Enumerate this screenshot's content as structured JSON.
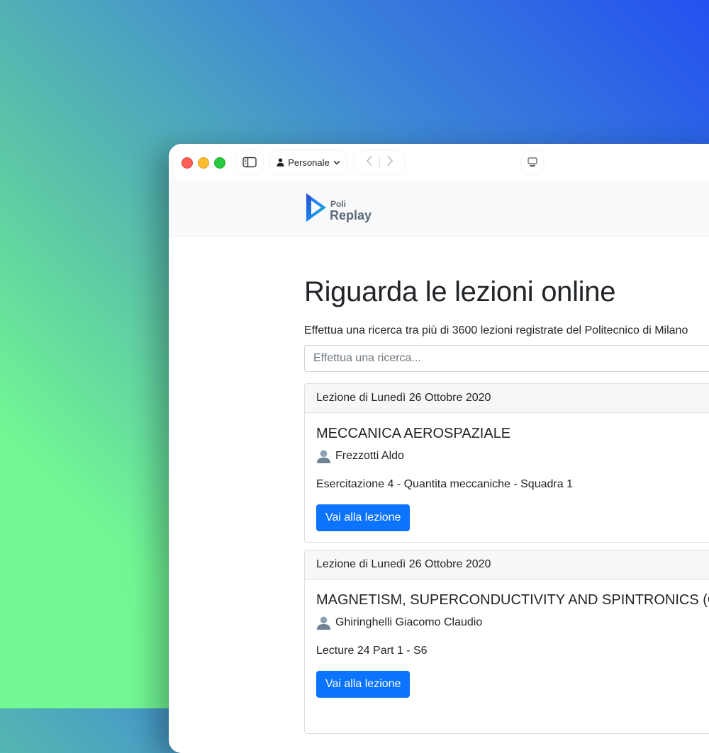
{
  "browser": {
    "profile_label": "Personale"
  },
  "brand": {
    "line1": "Poli",
    "line2": "Replay"
  },
  "page": {
    "title": "Riguarda le lezioni online",
    "subtitle": "Effettua una ricerca tra più di 3600 lezioni registrate del Politecnico di Milano"
  },
  "search": {
    "placeholder": "Effettua una ricerca...",
    "value": ""
  },
  "lessons": [
    {
      "date_header": "Lezione di Lunedì 26 Ottobre 2020",
      "course": "MECCANICA AEROSPAZIALE",
      "teacher": "Frezzotti Aldo",
      "lesson_title": "Esercitazione 4 - Quantita meccaniche - Squadra 1",
      "button_label": "Vai alla lezione"
    },
    {
      "date_header": "Lezione di Lunedì 26 Ottobre 2020",
      "course": "MAGNETISM, SUPERCONDUCTIVITY AND SPINTRONICS (C.I.)",
      "teacher": "Ghiringhelli Giacomo Claudio",
      "lesson_title": "Lecture 24 Part 1 - S6",
      "button_label": "Vai alla lezione"
    }
  ],
  "colors": {
    "primary": "#0b73fe",
    "traffic_red": "#fe5f57",
    "traffic_yellow": "#febc2e",
    "traffic_green": "#28c840"
  }
}
